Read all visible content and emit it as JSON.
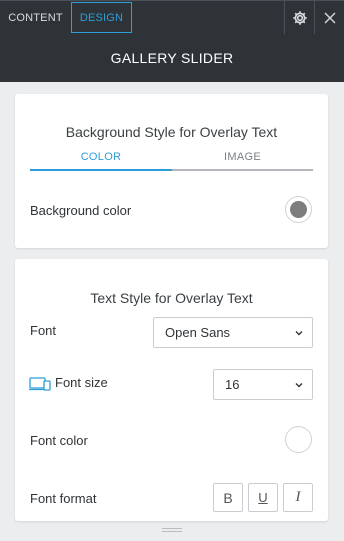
{
  "header": {
    "tabs": [
      {
        "label": "CONTENT",
        "active": false
      },
      {
        "label": "DESIGN",
        "active": true
      }
    ],
    "title": "GALLERY SLIDER"
  },
  "background_card": {
    "title": "Background Style for Overlay Text",
    "tabs": [
      {
        "label": "COLOR",
        "active": true
      },
      {
        "label": "IMAGE",
        "active": false
      }
    ],
    "background_color_label": "Background color",
    "background_color_value": "#7d7d7d"
  },
  "text_card": {
    "title": "Text Style for Overlay Text",
    "font_label": "Font",
    "font_value": "Open Sans",
    "font_size_label": "Font size",
    "font_size_value": "16",
    "font_color_label": "Font color",
    "font_color_value": "#ffffff",
    "font_format_label": "Font format",
    "format_buttons": [
      {
        "label": "B",
        "icon": "bold-icon"
      },
      {
        "label": "U",
        "icon": "underline-icon"
      },
      {
        "label": "I",
        "icon": "italic-icon"
      }
    ]
  },
  "colors": {
    "accent": "#2c9ed8",
    "header_bg": "#2e3338"
  }
}
